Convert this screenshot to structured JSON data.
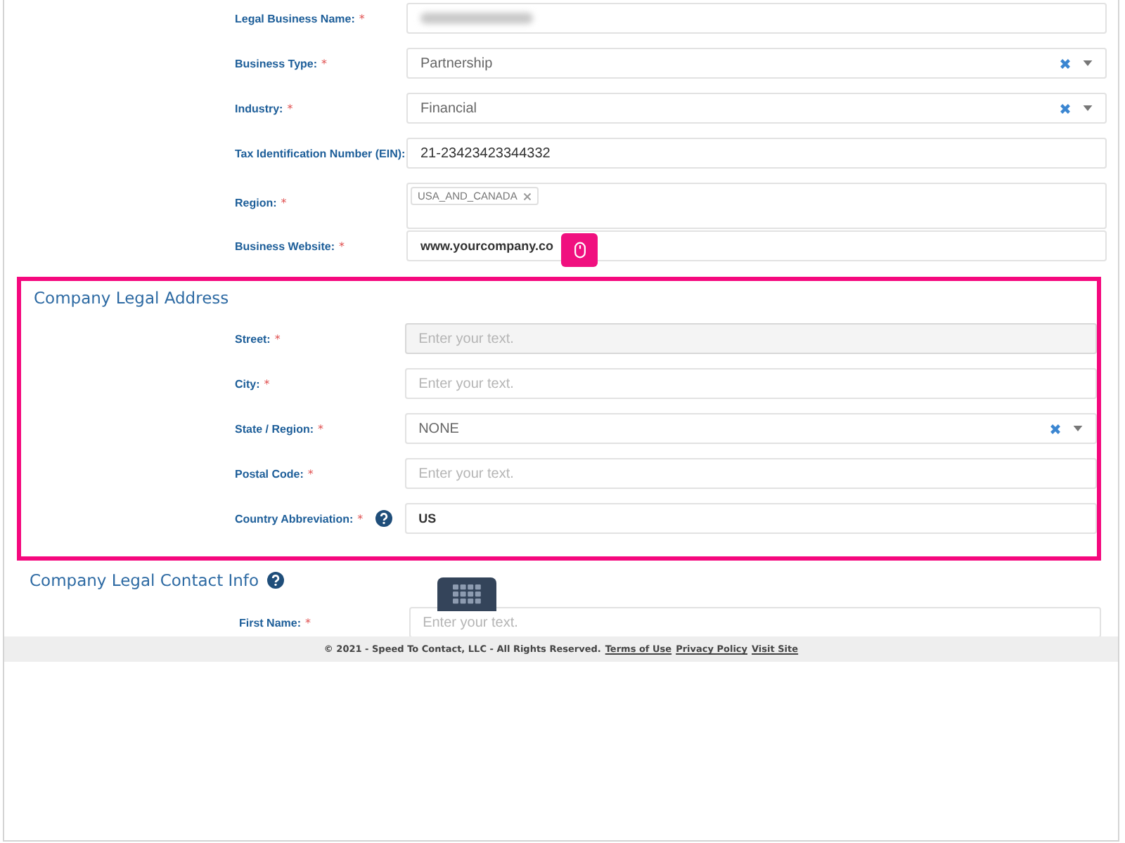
{
  "business_fields": [
    {
      "kind": "blurred",
      "label": "Legal Business Name:",
      "required_mark": "*"
    },
    {
      "kind": "select",
      "label": "Business Type:",
      "required_mark": "*",
      "value": "Partnership"
    },
    {
      "kind": "select",
      "label": "Industry:",
      "required_mark": "*",
      "value": "Financial"
    },
    {
      "kind": "text",
      "label": "Tax Identification Number (EIN):",
      "value": "21-23423423344332"
    },
    {
      "kind": "tags",
      "label": "Region:",
      "required_mark": "*",
      "tags": [
        "USA_AND_CANADA"
      ]
    },
    {
      "kind": "text",
      "label": "Business Website:",
      "required_mark": "*",
      "value": "www.yourcompany.co",
      "bold": true
    }
  ],
  "address_section": {
    "title": "Company Legal Address",
    "highlighted": true,
    "fields": [
      {
        "kind": "text",
        "label": "Street:",
        "required_mark": "*",
        "placeholder": "Enter your text.",
        "active": true
      },
      {
        "kind": "text",
        "label": "City:",
        "required_mark": "*",
        "placeholder": "Enter your text."
      },
      {
        "kind": "select",
        "label": "State / Region:",
        "required_mark": "*",
        "value": "NONE"
      },
      {
        "kind": "text",
        "label": "Postal Code:",
        "required_mark": "*",
        "placeholder": "Enter your text."
      },
      {
        "kind": "text",
        "label": "Country Abbreviation:",
        "required_mark": "*",
        "help": true,
        "value": "US",
        "bold": true
      }
    ]
  },
  "contact_section": {
    "title": "Company Legal Contact Info",
    "help": true,
    "fields": [
      {
        "kind": "text",
        "label": "First Name:",
        "required_mark": "*",
        "placeholder": "Enter your text."
      }
    ]
  },
  "footer": {
    "text": "© 2021 - Speed To Contact, LLC - All Rights Reserved.",
    "links": [
      "Terms of Use",
      "Privacy Policy",
      "Visit Site"
    ]
  }
}
